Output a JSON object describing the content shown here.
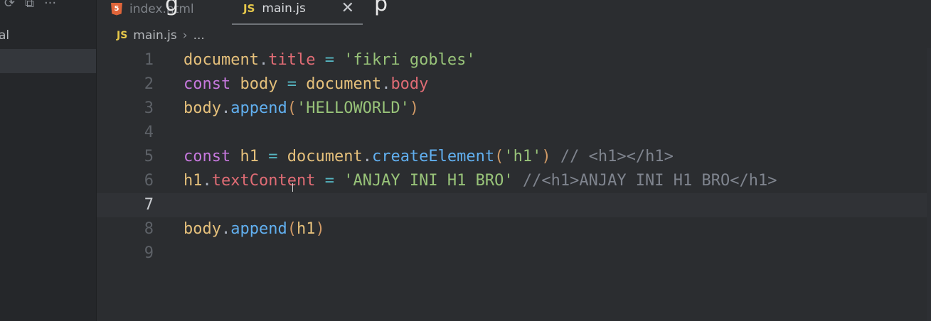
{
  "explorer": {
    "toolbar": [
      "⟳",
      "⧉",
      "···"
    ],
    "label": "al"
  },
  "tabs": [
    {
      "icon": "5",
      "label": "index.html",
      "active": false
    },
    {
      "icon": "JS",
      "label": "main.js",
      "active": true,
      "close": "✕"
    }
  ],
  "title_fragment": "p",
  "title_fragment_left": "g",
  "breadcrumb": {
    "icon": "JS",
    "file": "main.js",
    "sep": "›",
    "more": "..."
  },
  "editor": {
    "current_line": 7,
    "lines": [
      {
        "n": "1",
        "tokens": [
          [
            "t-var",
            "document"
          ],
          [
            "t-punc",
            "."
          ],
          [
            "t-prop",
            "title"
          ],
          [
            "t-op",
            " = "
          ],
          [
            "t-str",
            "'fikri gobles'"
          ]
        ]
      },
      {
        "n": "2",
        "tokens": [
          [
            "t-kw",
            "const"
          ],
          [
            "t-punc",
            " "
          ],
          [
            "t-var",
            "body"
          ],
          [
            "t-op",
            " = "
          ],
          [
            "t-var",
            "document"
          ],
          [
            "t-punc",
            "."
          ],
          [
            "t-prop",
            "body"
          ]
        ]
      },
      {
        "n": "3",
        "tokens": [
          [
            "t-var",
            "body"
          ],
          [
            "t-punc",
            "."
          ],
          [
            "t-fn",
            "append"
          ],
          [
            "t-paren",
            "("
          ],
          [
            "t-str",
            "'HELLOWORLD'"
          ],
          [
            "t-paren",
            ")"
          ]
        ]
      },
      {
        "n": "4",
        "tokens": []
      },
      {
        "n": "5",
        "tokens": [
          [
            "t-kw",
            "const"
          ],
          [
            "t-punc",
            " "
          ],
          [
            "t-var",
            "h1"
          ],
          [
            "t-op",
            " = "
          ],
          [
            "t-var",
            "document"
          ],
          [
            "t-punc",
            "."
          ],
          [
            "t-fn",
            "createElement"
          ],
          [
            "t-paren",
            "("
          ],
          [
            "t-str",
            "'h1'"
          ],
          [
            "t-paren",
            ")"
          ],
          [
            "t-com",
            " // <h1></h1>"
          ]
        ]
      },
      {
        "n": "6",
        "tokens": [
          [
            "t-var",
            "h1"
          ],
          [
            "t-punc",
            "."
          ],
          [
            "t-prop",
            "textContent"
          ],
          [
            "t-op",
            " = "
          ],
          [
            "t-str",
            "'ANJAY INI H1 BRO'"
          ],
          [
            "t-com",
            " //<h1>ANJAY INI H1 BRO</h1>"
          ]
        ]
      },
      {
        "n": "7",
        "tokens": []
      },
      {
        "n": "8",
        "tokens": [
          [
            "t-var",
            "body"
          ],
          [
            "t-punc",
            "."
          ],
          [
            "t-fn",
            "append"
          ],
          [
            "t-paren",
            "("
          ],
          [
            "t-var",
            "h1"
          ],
          [
            "t-paren",
            ")"
          ]
        ]
      },
      {
        "n": "9",
        "tokens": []
      }
    ]
  }
}
